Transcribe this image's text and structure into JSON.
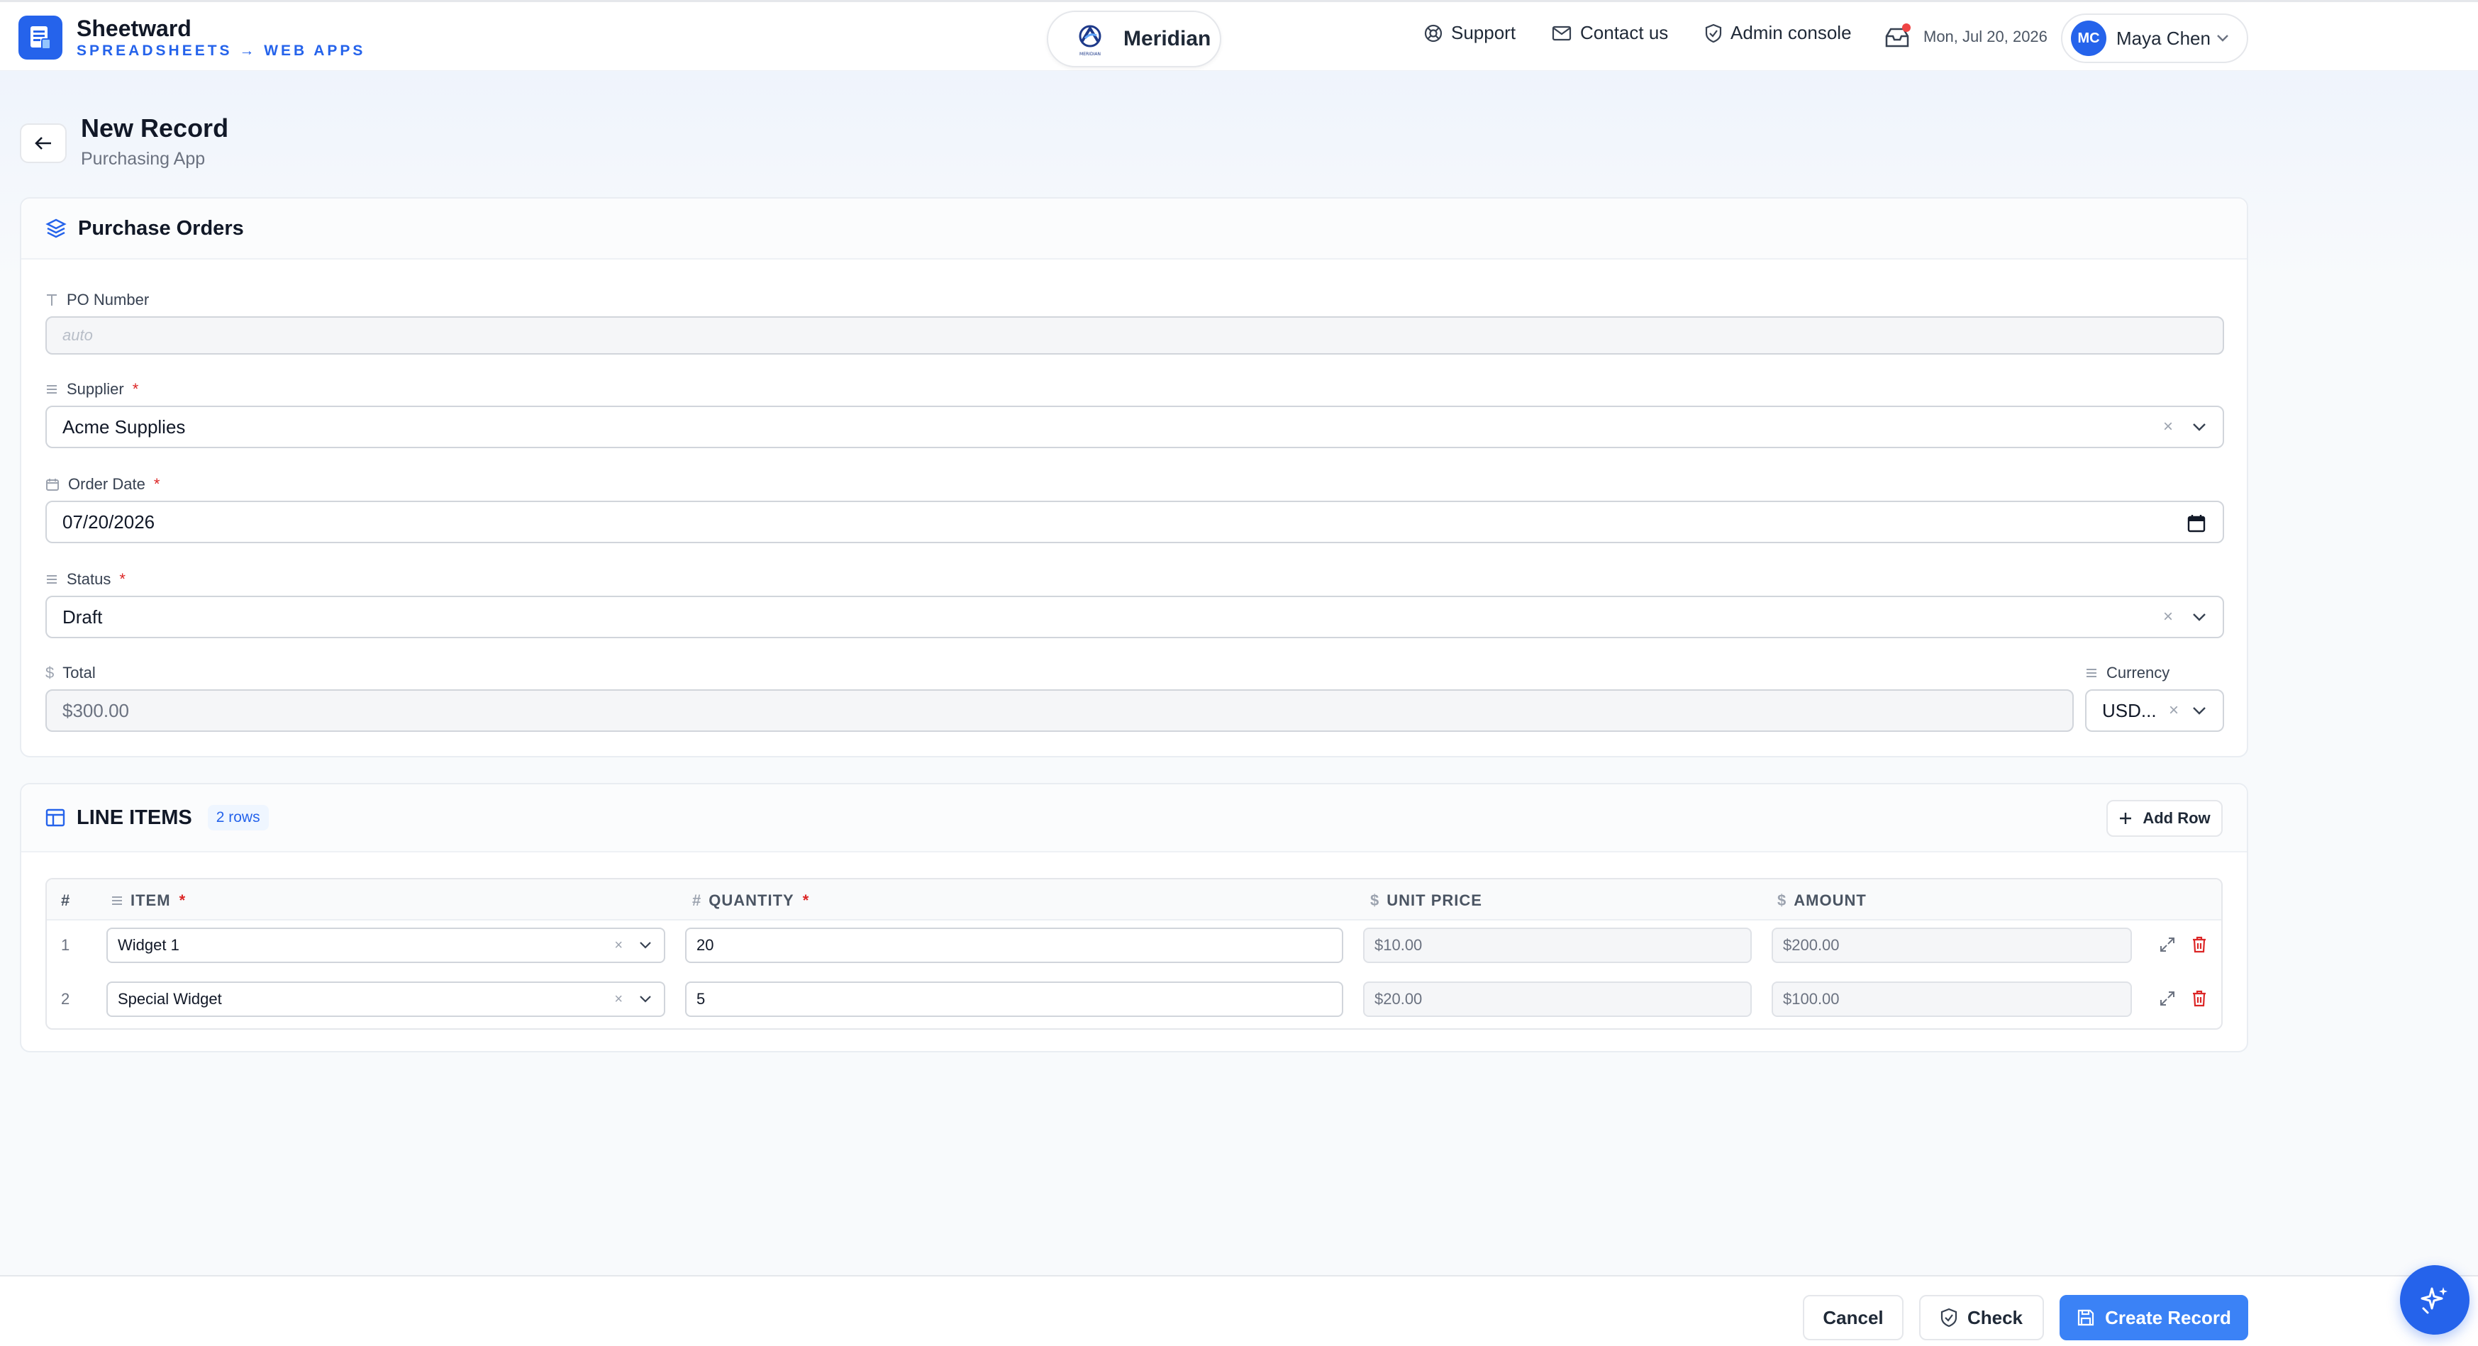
{
  "brand": {
    "name": "Sheetward",
    "tagline": "SPREADSHEETS → WEB APPS"
  },
  "tenant": {
    "name": "Meridian",
    "logo_caption": "MERIDIAN"
  },
  "nav": {
    "support": "Support",
    "contact": "Contact us",
    "admin": "Admin console"
  },
  "header": {
    "date": "Mon, Jul 20, 2026",
    "user_initials": "MC",
    "user_name": "Maya Chen"
  },
  "page": {
    "title": "New Record",
    "subtitle": "Purchasing App"
  },
  "form": {
    "section_title": "Purchase Orders",
    "po_number": {
      "label": "PO Number",
      "placeholder": "auto"
    },
    "supplier": {
      "label": "Supplier",
      "required": "*",
      "value": "Acme Supplies"
    },
    "order_date": {
      "label": "Order Date",
      "required": "*",
      "value": "07/20/2026"
    },
    "status": {
      "label": "Status",
      "required": "*",
      "value": "Draft"
    },
    "total": {
      "label": "Total",
      "value": "$300.00"
    },
    "currency": {
      "label": "Currency",
      "value": "USD..."
    }
  },
  "line_items": {
    "title": "LINE ITEMS",
    "count": "2 rows",
    "add_label": "Add Row",
    "columns": {
      "num": "#",
      "item": "ITEM",
      "quantity": "QUANTITY",
      "unit_price": "UNIT PRICE",
      "amount": "AMOUNT",
      "required": "*"
    },
    "rows": [
      {
        "num": "1",
        "item": "Widget 1",
        "quantity": "20",
        "unit_price": "$10.00",
        "amount": "$200.00"
      },
      {
        "num": "2",
        "item": "Special Widget",
        "quantity": "5",
        "unit_price": "$20.00",
        "amount": "$100.00"
      }
    ]
  },
  "footer": {
    "cancel": "Cancel",
    "check": "Check",
    "create": "Create Record"
  },
  "colors": {
    "accent": "#2563eb",
    "primary_button": "#3b82f6",
    "required": "#dc2626",
    "notification_dot": "#ef4444",
    "delete": "#dc2626"
  },
  "icons": {
    "brand": "spreadsheet-icon",
    "support": "lifebuoy-icon",
    "contact": "mail-icon",
    "admin": "shield-icon",
    "inbox": "inbox-icon",
    "back": "arrow-left-icon",
    "section": "layers-icon",
    "grid": "table-icon",
    "expand": "expand-icon",
    "delete": "trash-icon",
    "assistant": "sparkle-icon"
  }
}
